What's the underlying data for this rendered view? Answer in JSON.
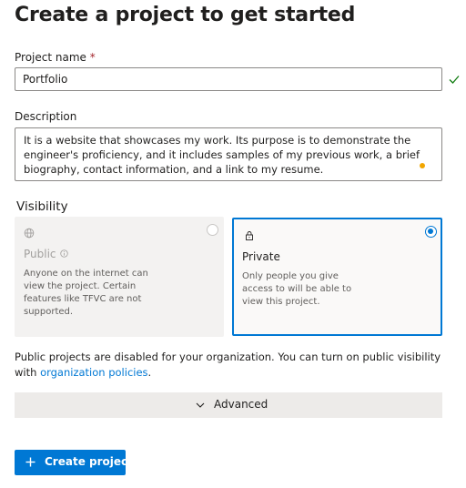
{
  "header": {
    "title": "Create a project to get started"
  },
  "project_name": {
    "label": "Project name",
    "required_marker": "*",
    "value": "Portfolio",
    "valid_icon": "check-icon"
  },
  "description": {
    "label": "Description",
    "value": "It is a website that showcases my work. Its purpose is to demonstrate the engineer's proficiency, and it includes samples of my previous work, a brief biography, contact information, and a link to my resume."
  },
  "visibility": {
    "label": "Visibility",
    "options": [
      {
        "title": "Public",
        "icon": "globe-icon",
        "info_icon": "info-icon",
        "description": "Anyone on the internet can view the project. Certain features like TFVC are not supported.",
        "selected": false,
        "disabled": true
      },
      {
        "title": "Private",
        "icon": "lock-icon",
        "description": "Only people you give access to will be able to view this project.",
        "selected": true,
        "disabled": false
      }
    ]
  },
  "notice": {
    "text": "Public projects are disabled for your organization. You can turn on public visibility with ",
    "link": "organization policies",
    "suffix": "."
  },
  "advanced": {
    "label": "Advanced",
    "icon": "chevron-down-icon"
  },
  "create_button": {
    "label": "Create project",
    "icon": "plus-icon"
  },
  "colors": {
    "accent": "#0078d4",
    "required": "#a4262c",
    "valid": "#107c10",
    "spell_dot": "#f2a600"
  }
}
